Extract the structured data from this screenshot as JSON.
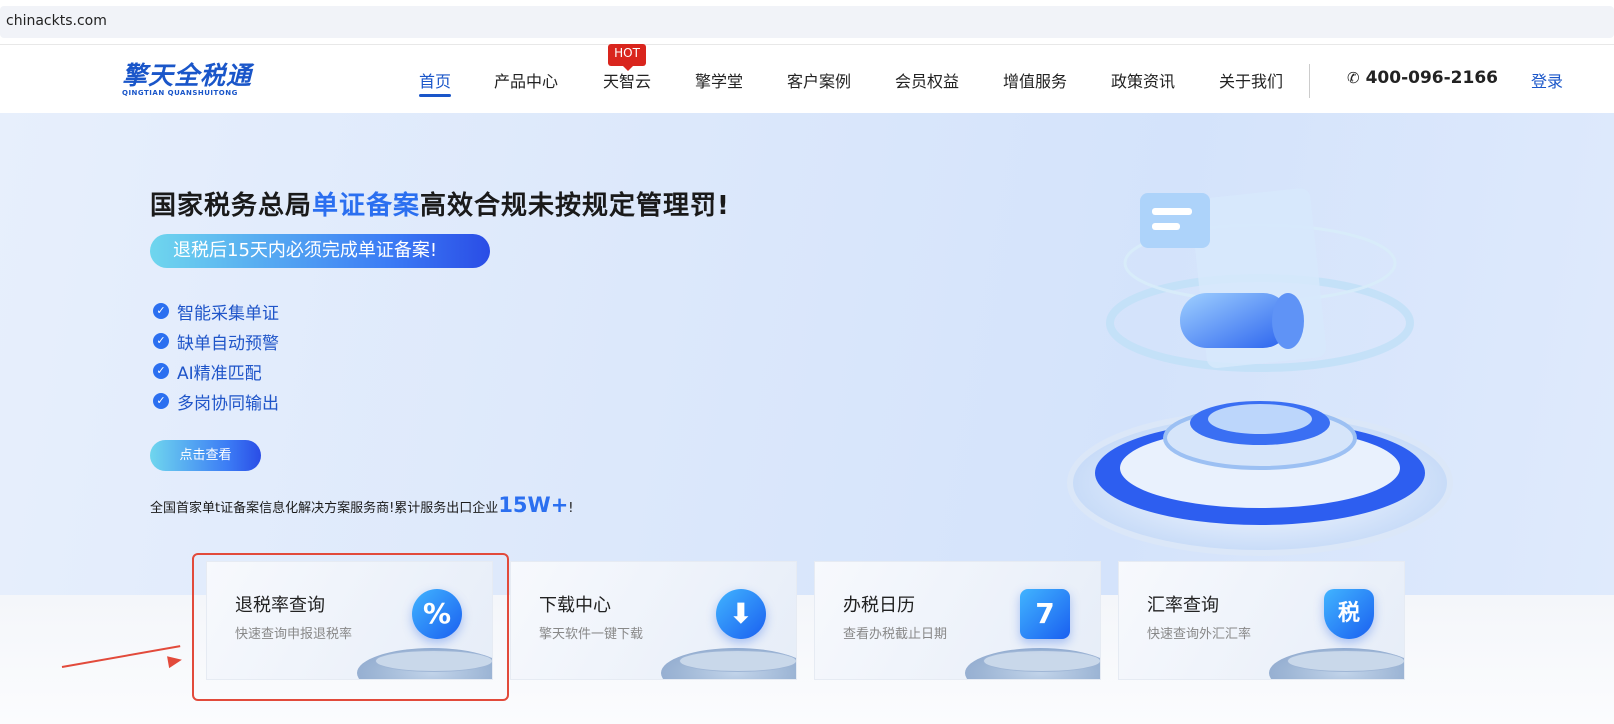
{
  "address_bar": {
    "url": "chinackts.com"
  },
  "logo": {
    "name_cn": "擎天全税通",
    "name_en": "QINGTIAN QUANSHUITONG"
  },
  "nav": {
    "items": [
      {
        "label": "首页",
        "active": true
      },
      {
        "label": "产品中心"
      },
      {
        "label": "天智云",
        "badge": "HOT"
      },
      {
        "label": "擎学堂"
      },
      {
        "label": "客户案例"
      },
      {
        "label": "会员权益"
      },
      {
        "label": "增值服务"
      },
      {
        "label": "政策资讯"
      },
      {
        "label": "关于我们"
      }
    ],
    "phone": "400-096-2166",
    "login": "登录"
  },
  "hero": {
    "title_pre": "国家税务总局",
    "title_highlight": "单证备案",
    "title_post": "高效合规未按规定管理罚!",
    "pill": "退税后15天内必须完成单证备案!",
    "features": [
      "智能采集单证",
      "缺单自动预警",
      "AI精准匹配",
      "多岗协同输出"
    ],
    "cta": "点击查看",
    "foot_pre": "全国首家单t证备案信息化解决方案服务商!累计服务出口企业",
    "foot_big": "15W+",
    "foot_post": "!"
  },
  "cards": [
    {
      "title": "退税率查询",
      "subtitle": "快速查询申报退税率",
      "icon": "percent-icon",
      "glyph": "%"
    },
    {
      "title": "下载中心",
      "subtitle": "擎天软件一键下载",
      "icon": "cloud-download-icon",
      "glyph": "⬇"
    },
    {
      "title": "办税日历",
      "subtitle": "查看办税截止日期",
      "icon": "calendar-icon",
      "glyph": "7"
    },
    {
      "title": "汇率查询",
      "subtitle": "快速查询外汇汇率",
      "icon": "tax-shield-icon",
      "glyph": "税"
    }
  ],
  "colors": {
    "brand": "#1a56c9",
    "accent": "#2b6ff0",
    "annotation": "#e24a3b",
    "hot": "#d9251d"
  }
}
